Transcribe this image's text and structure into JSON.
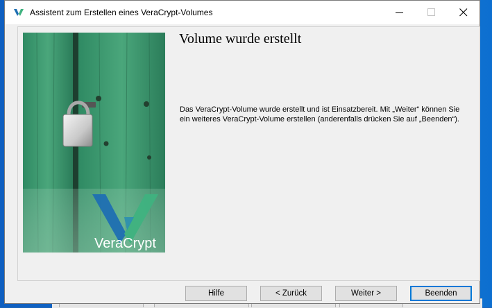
{
  "window": {
    "title": "Assistent zum Erstellen eines VeraCrypt-Volumes",
    "app_icon": "veracrypt-logo-icon"
  },
  "page": {
    "heading": "Volume wurde erstellt",
    "info": "Das VeraCrypt-Volume wurde erstellt und ist Einsatzbereit. Mit „Weiter“ können Sie ein weiteres VeraCrypt-Volume erstellen (anderenfalls drücken Sie auf „Beenden“)."
  },
  "side_image": {
    "brand": "VeraCrypt",
    "description_icon": "padlock-on-green-door"
  },
  "buttons": {
    "help": "Hilfe",
    "back": "< Zurück",
    "next": "Weiter >",
    "finish": "Beenden"
  },
  "colors": {
    "accent": "#0078d7",
    "door_green": "#3f9a6e",
    "logo_blue": "#1f6fb2",
    "logo_green": "#3fb27f"
  }
}
